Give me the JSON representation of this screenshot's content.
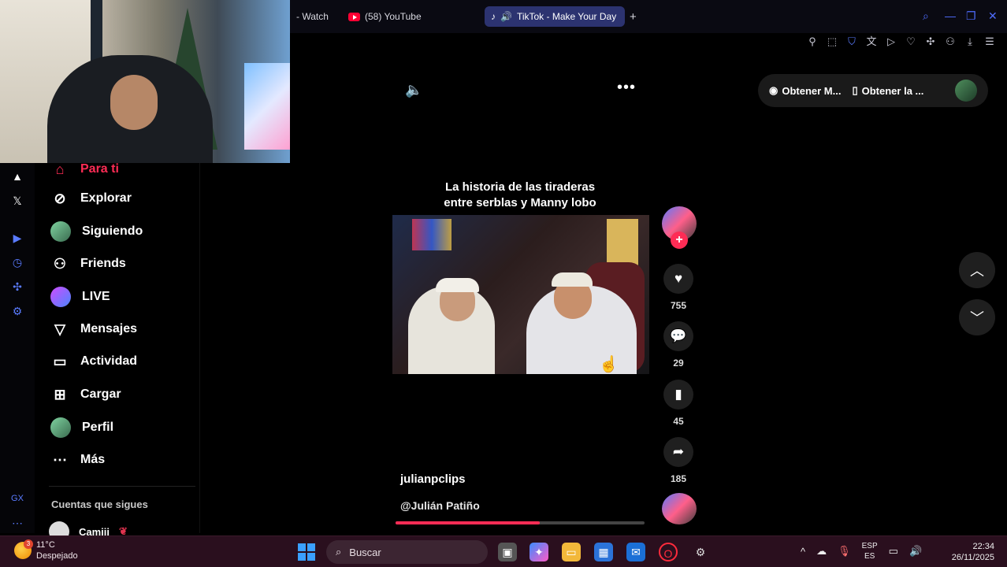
{
  "browser": {
    "tabs": [
      {
        "label": "- Watch"
      },
      {
        "label": "(58) YouTube"
      },
      {
        "label": "TikTok - Make Your Day"
      }
    ],
    "new_tab_label": "+"
  },
  "sidebar": {
    "nav": [
      {
        "label": "Para ti"
      },
      {
        "label": "Explorar"
      },
      {
        "label": "Siguiendo"
      },
      {
        "label": "Friends"
      },
      {
        "label": "LIVE"
      },
      {
        "label": "Mensajes"
      },
      {
        "label": "Actividad"
      },
      {
        "label": "Cargar"
      },
      {
        "label": "Perfil"
      },
      {
        "label": "Más"
      }
    ],
    "following_header": "Cuentas que sigues",
    "following": [
      {
        "name": "Camiii"
      }
    ]
  },
  "video": {
    "title_line1": "La historia de las tiraderas",
    "title_line2": "entre serblas y Manny lobo",
    "author": "julianpclips",
    "handle": "@Julián Patiño",
    "progress": 0.58
  },
  "actions": {
    "likes": "755",
    "comments": "29",
    "saves": "45",
    "shares": "185"
  },
  "top_pill": {
    "item1": "Obtener M...",
    "item2": "Obtener la ..."
  },
  "taskbar": {
    "weather_temp": "11°C",
    "weather_desc": "Despejado",
    "weather_badge": "3",
    "search_placeholder": "Buscar",
    "lang_line1": "ESP",
    "lang_line2": "ES",
    "time": "22:34",
    "date": "26/11/2025"
  },
  "colors": {
    "accent": "#fe2c55",
    "tab_active": "#2c3370",
    "taskbar": "#2a0f1e"
  }
}
